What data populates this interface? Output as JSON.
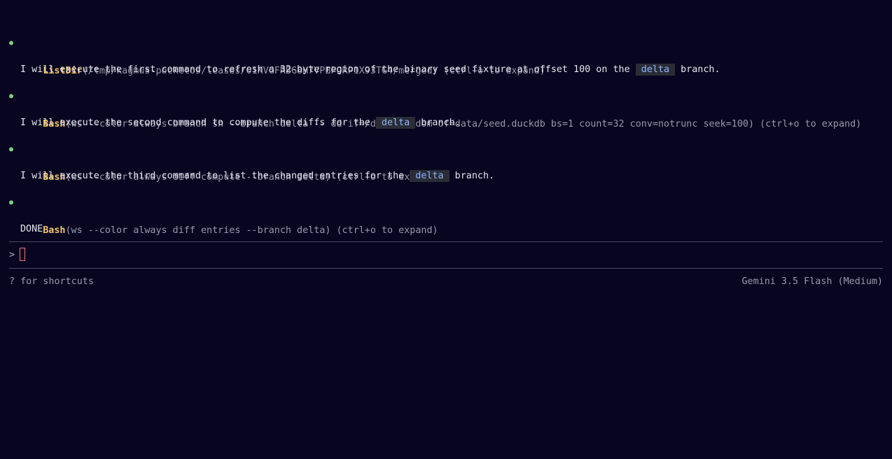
{
  "transcript": {
    "entry1": {
      "tool": "ListDir",
      "args": "(/tmp/kagmus-pocketos/leases/01KVGFRBG8H7VPBPQRP1X93TG4/merged)",
      "hint": " (ctrl+o to expand)"
    },
    "msg1": {
      "before": "I will execute the first command to refresh a 32-byte region of the binary seed fixture at offset 100 on the ",
      "code": "delta",
      "after": " branch."
    },
    "entry2": {
      "tool": "Bash",
      "args": "(ws --color always branch sh --branch delta -- dd if=/dev/urandom of=data/seed.duckdb bs=1 count=32 conv=notrunc seek=100)",
      "hint": " (ctrl+o to expand)"
    },
    "msg2": {
      "before": "I will execute the second command to compute the diffs for the ",
      "code": "delta",
      "after": " branch."
    },
    "entry3": {
      "tool": "Bash",
      "args": "(ws --color always diff compute --branch delta)",
      "hint": " (ctrl+o to expand)"
    },
    "msg3": {
      "before": "I will execute the third command to list the changed entries for the ",
      "code": "delta",
      "after": " branch."
    },
    "entry4": {
      "tool": "Bash",
      "args": "(ws --color always diff entries --branch delta)",
      "hint": " (ctrl+o to expand)"
    },
    "final": "DONE"
  },
  "input": {
    "prompt_symbol": ">",
    "value": ""
  },
  "footer": {
    "shortcuts_hint": "? for shortcuts",
    "model": "Gemini 3.5 Flash (Medium)"
  },
  "colors": {
    "background": "#080520",
    "tool_name": "#f5c66a",
    "bullet": "#7ed07e",
    "code_text": "#8fb5ff",
    "cursor_border": "#f07a7a"
  }
}
